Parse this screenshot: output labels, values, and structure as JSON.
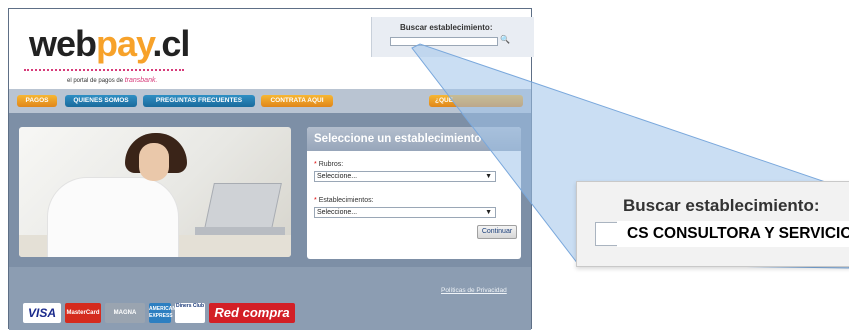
{
  "brand": {
    "logo_web": "web",
    "logo_pay": "pay",
    "logo_cl": ".cl",
    "tagline": "el portal de pagos de",
    "tagline_brand": "transbank."
  },
  "search": {
    "label": "Buscar establecimiento:",
    "value": ""
  },
  "nav": {
    "items": [
      "PAGOS",
      "QUIENES SOMOS",
      "PREGUNTAS FRECUENTES",
      "CONTRATA AQUI",
      "¿QUE"
    ]
  },
  "panel": {
    "title": "Seleccione un establecimiento",
    "rubros_label": "Rubros:",
    "rubros_value": "Seleccione...",
    "establecimientos_label": "Establecimientos:",
    "establecimientos_value": "Seleccione...",
    "required_marker": "*",
    "continue_label": "Continuar"
  },
  "footer": {
    "privacy_link": "Políticas de Privacidad",
    "cards": {
      "visa": "VISA",
      "mastercard": "MasterCard",
      "magna": "MAGNA",
      "amex": "AMERICAN EXPRESS",
      "diners": "Diners Club",
      "redcompra": "Red compra"
    }
  },
  "callout": {
    "label": "Buscar establecimiento:",
    "value": "CS CONSULTORA Y SERVICIOS"
  },
  "colors": {
    "accent_orange": "#f7a22a",
    "nav_blue": "#1a6a9c",
    "brand_pink": "#d73b7a",
    "page_bg": "#7d8fa6"
  }
}
